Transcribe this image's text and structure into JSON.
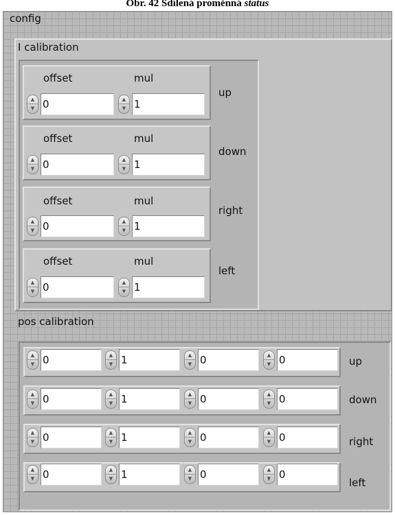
{
  "caption": {
    "prefix": "Obr. 42 Sdílená proměnná",
    "italic": "status"
  },
  "config": {
    "label": "config",
    "i_calibration": {
      "label": "I calibration",
      "offset_label": "offset",
      "mul_label": "mul",
      "rows": [
        {
          "name": "up",
          "offset": "0",
          "mul": "1"
        },
        {
          "name": "down",
          "offset": "0",
          "mul": "1"
        },
        {
          "name": "right",
          "offset": "0",
          "mul": "1"
        },
        {
          "name": "left",
          "offset": "0",
          "mul": "1"
        }
      ]
    },
    "pos_calibration": {
      "label": "pos calibration",
      "rows": [
        {
          "name": "up",
          "values": [
            "0",
            "1",
            "0",
            "0"
          ]
        },
        {
          "name": "down",
          "values": [
            "0",
            "1",
            "0",
            "0"
          ]
        },
        {
          "name": "right",
          "values": [
            "0",
            "1",
            "0",
            "0"
          ]
        },
        {
          "name": "left",
          "values": [
            "0",
            "1",
            "0",
            "0"
          ]
        }
      ]
    }
  }
}
